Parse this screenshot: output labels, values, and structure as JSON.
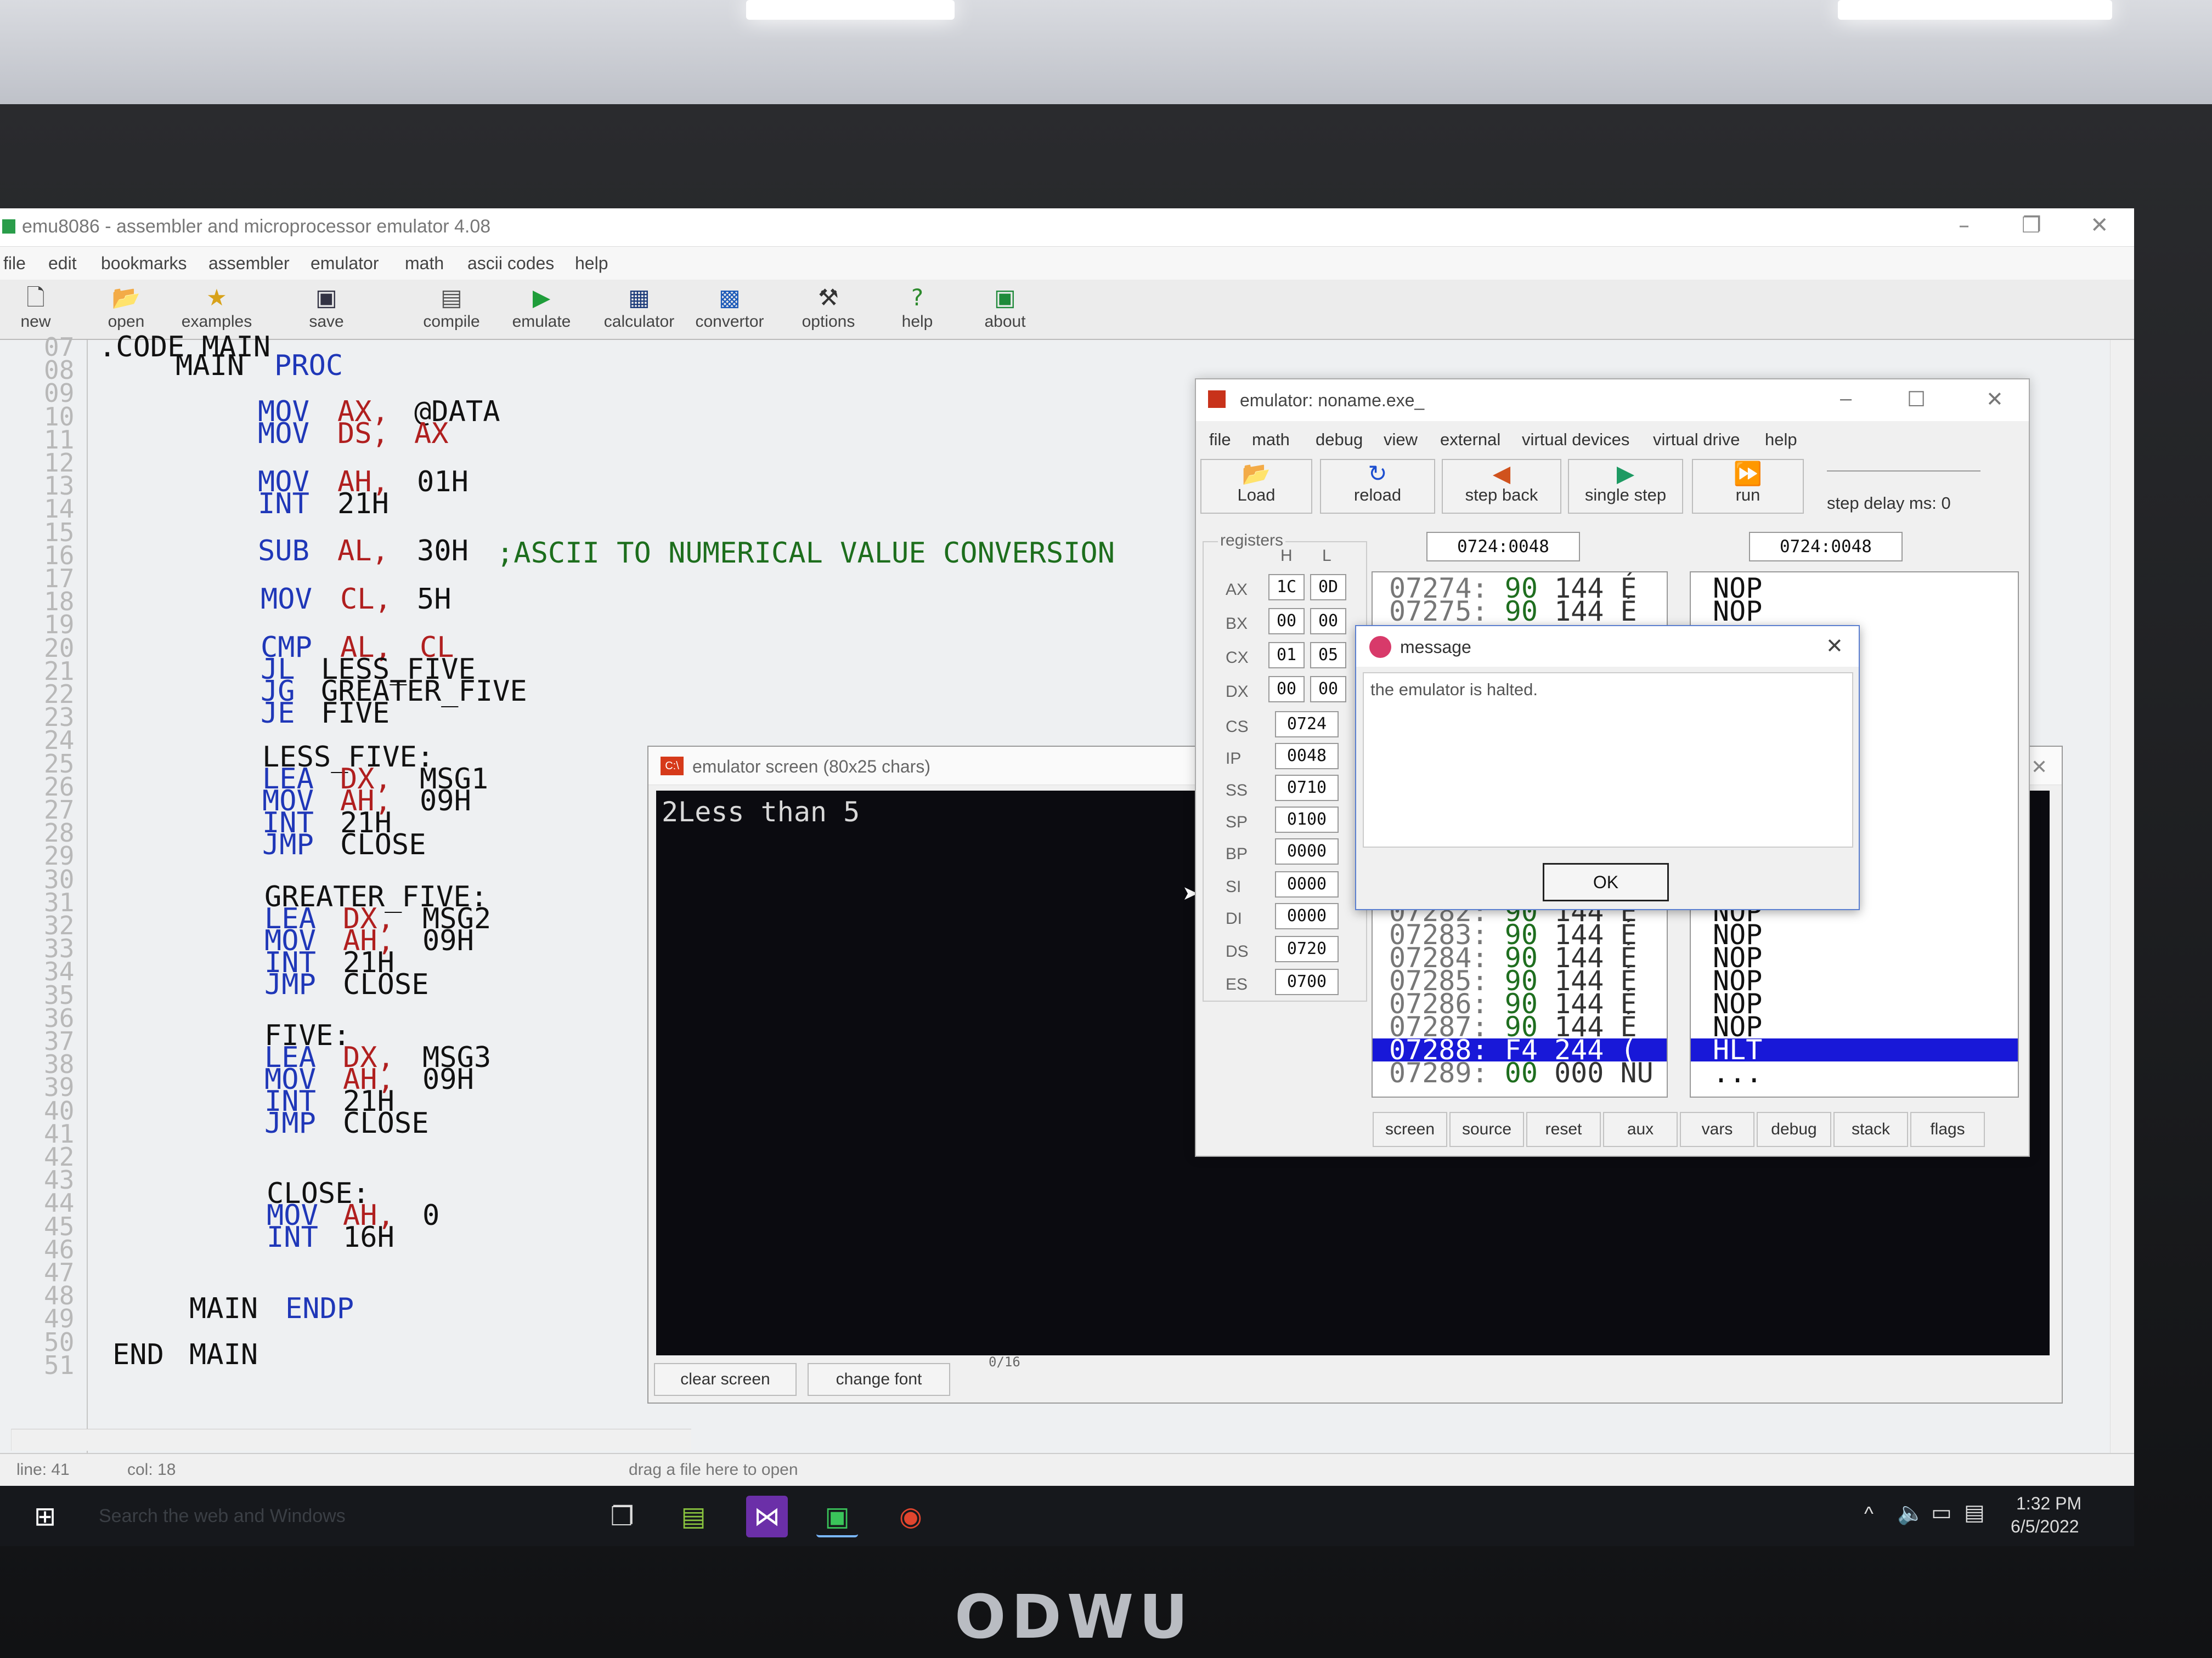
{
  "main_window": {
    "title": "emu8086 - assembler and microprocessor emulator 4.08",
    "menu": [
      "file",
      "edit",
      "bookmarks",
      "assembler",
      "emulator",
      "math",
      "ascii codes",
      "help"
    ],
    "toolbar": [
      {
        "label": "new",
        "icon": "new-file-icon"
      },
      {
        "label": "open",
        "icon": "open-folder-icon"
      },
      {
        "label": "examples",
        "icon": "star-icon"
      },
      {
        "label": "save",
        "icon": "floppy-icon"
      },
      {
        "label": "compile",
        "icon": "compile-icon"
      },
      {
        "label": "emulate",
        "icon": "play-icon"
      },
      {
        "label": "calculator",
        "icon": "calculator-icon"
      },
      {
        "label": "convertor",
        "icon": "convertor-icon"
      },
      {
        "label": "options",
        "icon": "tools-icon"
      },
      {
        "label": "help",
        "icon": "help-icon"
      },
      {
        "label": "about",
        "icon": "chip-icon"
      }
    ]
  },
  "editor": {
    "line_numbers": [
      "07",
      "08",
      "09",
      "10",
      "11",
      "12",
      "13",
      "14",
      "15",
      "16",
      "17",
      "18",
      "19",
      "20",
      "21",
      "22",
      "23",
      "24",
      "25",
      "26",
      "27",
      "28",
      "29",
      "30",
      "31",
      "32",
      "33",
      "34",
      "35",
      "36",
      "37",
      "38",
      "39",
      "40",
      "41",
      "42",
      "43",
      "44",
      "45",
      "46",
      "47",
      "48",
      "49",
      "50",
      "51"
    ],
    "code": {
      "l07": ".CODE MAIN",
      "l08a": "MAIN",
      "l08b": "PROC",
      "l10a": "MOV",
      "l10b": "AX,",
      "l10c": "@DATA",
      "l11a": "MOV",
      "l11b": "DS,",
      "l11c": "AX",
      "l13a": "MOV",
      "l13b": "AH,",
      "l13c": "01H",
      "l14a": "INT",
      "l14c": "21H",
      "l16a": "SUB",
      "l16b": "AL,",
      "l16c": "30H",
      "l16d": ";ASCII TO NUMERICAL VALUE CONVERSION",
      "l18a": "MOV",
      "l18b": "CL,",
      "l18c": "5H",
      "l20a": "CMP",
      "l20b": "AL,",
      "l20c": "CL",
      "l21a": "JL",
      "l21c": "LESS_FIVE",
      "l22a": "JG",
      "l22c": "GREATER_FIVE",
      "l23a": "JE",
      "l23c": "FIVE",
      "l25": "LESS_FIVE:",
      "l26a": "LEA",
      "l26b": "DX,",
      "l26c": "MSG1",
      "l27a": "MOV",
      "l27b": "AH,",
      "l27c": "09H",
      "l28a": "INT",
      "l28c": "21H",
      "l29a": "JMP",
      "l29c": "CLOSE",
      "l31": "GREATER_FIVE:",
      "l32a": "LEA",
      "l32b": "DX,",
      "l32c": "MSG2",
      "l33a": "MOV",
      "l33b": "AH,",
      "l33c": "09H",
      "l34a": "INT",
      "l34c": "21H",
      "l35a": "JMP",
      "l35c": "CLOSE",
      "l37": "FIVE:",
      "l38a": "LEA",
      "l38b": "DX,",
      "l38c": "MSG3",
      "l39a": "MOV",
      "l39b": "AH,",
      "l39c": "09H",
      "l40a": "INT",
      "l40c": "21H",
      "l41a": "JMP",
      "l41c": "CLOSE",
      "l44": "CLOSE:",
      "l45a": "MOV",
      "l45b": "AH,",
      "l45c": "0",
      "l46a": "INT",
      "l46c": "16H",
      "l49a": "MAIN",
      "l49b": "ENDP",
      "l51a": "END",
      "l51b": "MAIN"
    }
  },
  "status": {
    "line": "line: 41",
    "col": "col: 18",
    "drop_hint": "drag a file here to open"
  },
  "emulator_screen": {
    "title": "emulator screen (80x25 chars)",
    "output": "2Less than 5",
    "clear_label": "clear screen",
    "font_label": "change font",
    "counter": "0/16"
  },
  "emulator": {
    "title": "emulator: noname.exe_",
    "menu": [
      "file",
      "math",
      "debug",
      "view",
      "external",
      "virtual devices",
      "virtual drive",
      "help"
    ],
    "buttons": [
      {
        "label": "Load",
        "icon": "open-folder-icon"
      },
      {
        "label": "reload",
        "icon": "reload-icon"
      },
      {
        "label": "step back",
        "icon": "step-back-icon"
      },
      {
        "label": "single step",
        "icon": "single-step-icon"
      },
      {
        "label": "run",
        "icon": "run-icon"
      }
    ],
    "step_delay": "step delay ms: 0",
    "registers_label": "registers",
    "hl_header": {
      "h": "H",
      "l": "L"
    },
    "split_registers": [
      {
        "name": "AX",
        "h": "1C",
        "l": "0D"
      },
      {
        "name": "BX",
        "h": "00",
        "l": "00"
      },
      {
        "name": "CX",
        "h": "01",
        "l": "05"
      },
      {
        "name": "DX",
        "h": "00",
        "l": "00"
      }
    ],
    "registers": [
      {
        "name": "CS",
        "value": "0724"
      },
      {
        "name": "IP",
        "value": "0048"
      },
      {
        "name": "SS",
        "value": "0710"
      },
      {
        "name": "SP",
        "value": "0100"
      },
      {
        "name": "BP",
        "value": "0000"
      },
      {
        "name": "SI",
        "value": "0000"
      },
      {
        "name": "DI",
        "value": "0000"
      },
      {
        "name": "DS",
        "value": "0720"
      },
      {
        "name": "ES",
        "value": "0700"
      }
    ],
    "address_left": "0724:0048",
    "address_right": "0724:0048",
    "memory": [
      {
        "addr": "07274:",
        "hex": "90",
        "dec": "144",
        "chr": "É"
      },
      {
        "addr": "07275:",
        "hex": "90",
        "dec": "144",
        "chr": "É"
      },
      {
        "addr": "07282:",
        "hex": "90",
        "dec": "144",
        "chr": "É"
      },
      {
        "addr": "07283:",
        "hex": "90",
        "dec": "144",
        "chr": "É"
      },
      {
        "addr": "07284:",
        "hex": "90",
        "dec": "144",
        "chr": "É"
      },
      {
        "addr": "07285:",
        "hex": "90",
        "dec": "144",
        "chr": "É"
      },
      {
        "addr": "07286:",
        "hex": "90",
        "dec": "144",
        "chr": "É"
      },
      {
        "addr": "07287:",
        "hex": "90",
        "dec": "144",
        "chr": "É"
      },
      {
        "addr": "07288:",
        "hex": "F4",
        "dec": "244",
        "chr": "("
      },
      {
        "addr": "07289:",
        "hex": "00",
        "dec": "000",
        "chr": "NU"
      }
    ],
    "disasm": [
      "NOP",
      "NOP",
      "NOP",
      "NOP",
      "NOP",
      "NOP",
      "NOP",
      "NOP",
      "HLT",
      "..."
    ],
    "tabs": [
      "screen",
      "source",
      "reset",
      "aux",
      "vars",
      "debug",
      "stack",
      "flags"
    ]
  },
  "message": {
    "title": "message",
    "text": "the emulator is halted.",
    "ok": "OK"
  },
  "taskbar": {
    "search_placeholder": "Search the web and Windows",
    "time": "1:32 PM",
    "date": "6/5/2022"
  },
  "monitor_brand": "Odwu",
  "colors": {
    "keyword": "#1f37b8",
    "register": "#b01f1f",
    "comment": "#1d6e1d",
    "selection": "#1818d8"
  }
}
